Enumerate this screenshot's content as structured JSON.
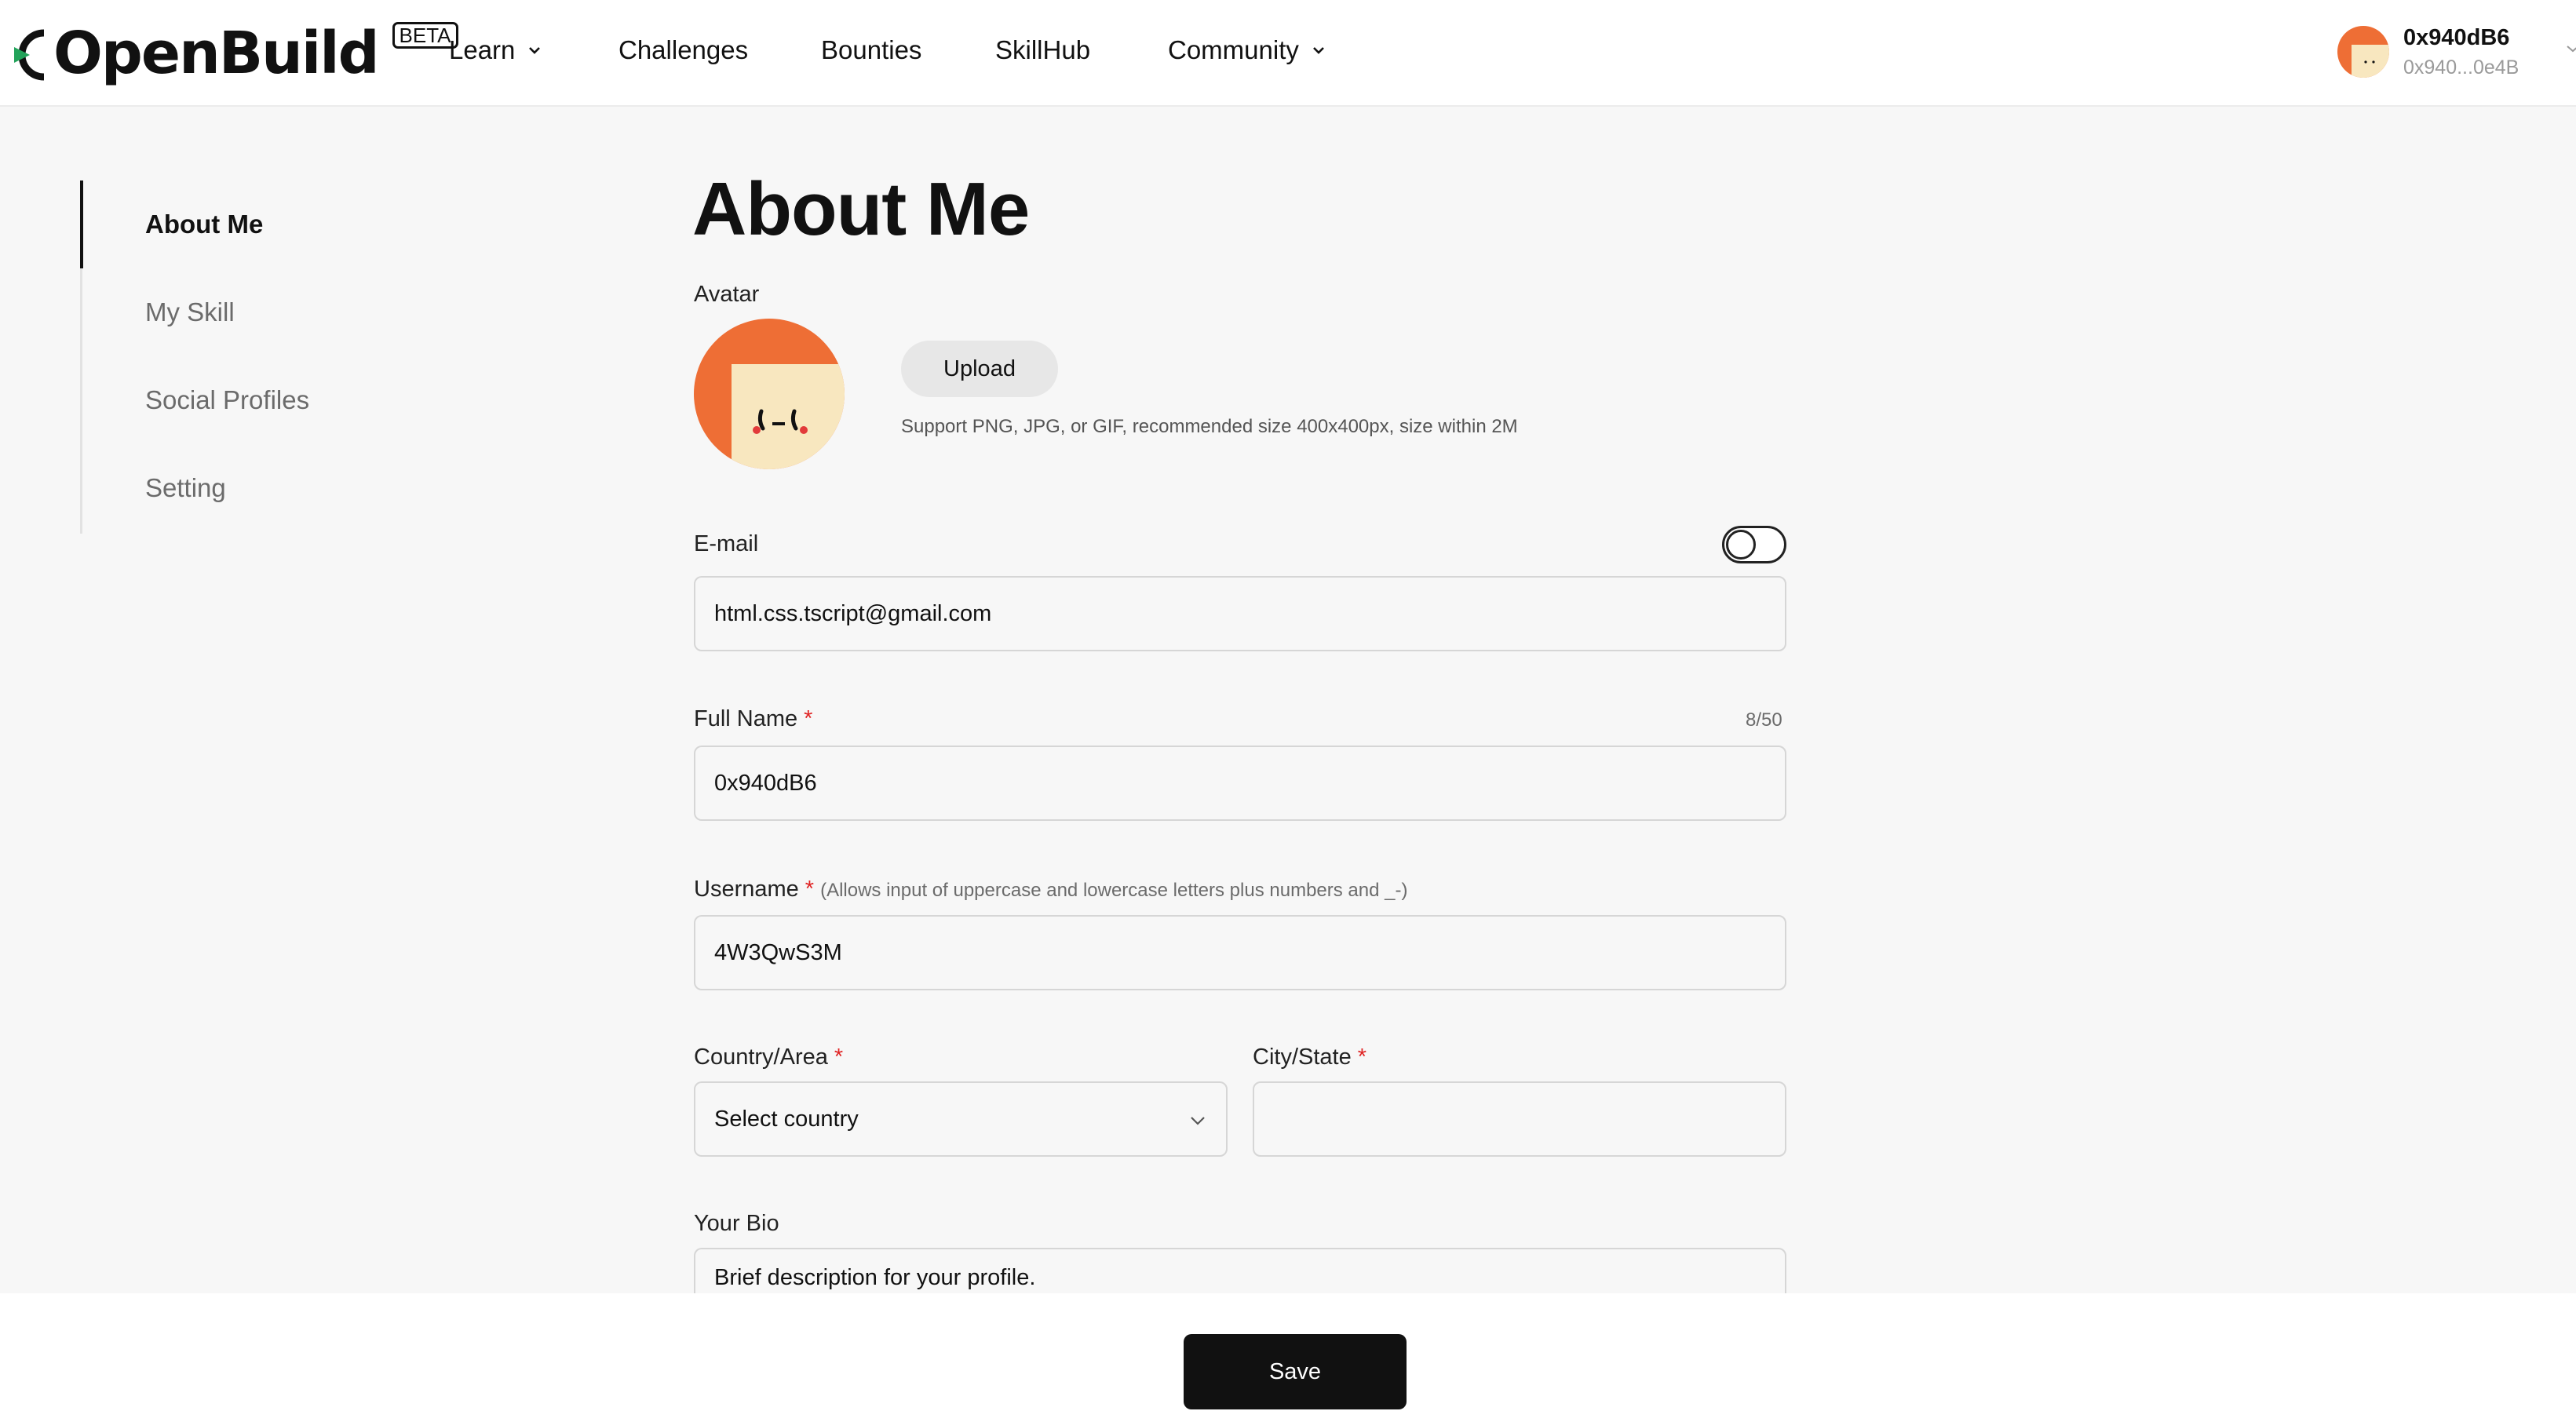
{
  "header": {
    "brand": "OpenBuild",
    "beta_badge": "BETA",
    "nav": [
      {
        "label": "Learn"
      },
      {
        "label": "Challenges"
      },
      {
        "label": "Bounties"
      },
      {
        "label": "SkillHub"
      },
      {
        "label": "Community"
      }
    ],
    "user": {
      "name": "0x940dB6",
      "address": "0x940...0e4B"
    }
  },
  "sidebar": {
    "items": [
      {
        "label": "About Me",
        "active": true
      },
      {
        "label": "My Skill"
      },
      {
        "label": "Social Profiles"
      },
      {
        "label": "Setting"
      }
    ]
  },
  "main": {
    "title": "About Me",
    "avatar": {
      "label": "Avatar",
      "upload_label": "Upload",
      "hint": "Support PNG, JPG, or GIF, recommended size 400x400px, size within 2M"
    },
    "email": {
      "label": "E-mail",
      "value": "html.css.tscript@gmail.com",
      "visibility_toggle_on": false
    },
    "full_name": {
      "label": "Full Name",
      "required_mark": "*",
      "value": "0x940dB6",
      "counter": "8/50"
    },
    "username": {
      "label": "Username",
      "required_mark": "*",
      "hint": "(Allows input of uppercase and lowercase letters plus numbers and _-)",
      "value": "4W3QwS3M"
    },
    "country": {
      "label": "Country/Area",
      "required_mark": "*",
      "placeholder": "Select country"
    },
    "city": {
      "label": "City/State",
      "required_mark": "*",
      "value": ""
    },
    "bio": {
      "label": "Your Bio",
      "placeholder": "Brief description for your profile."
    }
  },
  "footer": {
    "save_label": "Save"
  },
  "colors": {
    "accent": "#111111",
    "avatar_orange": "#ee6e35",
    "avatar_cream": "#f8e7bf",
    "required": "#e02424"
  }
}
